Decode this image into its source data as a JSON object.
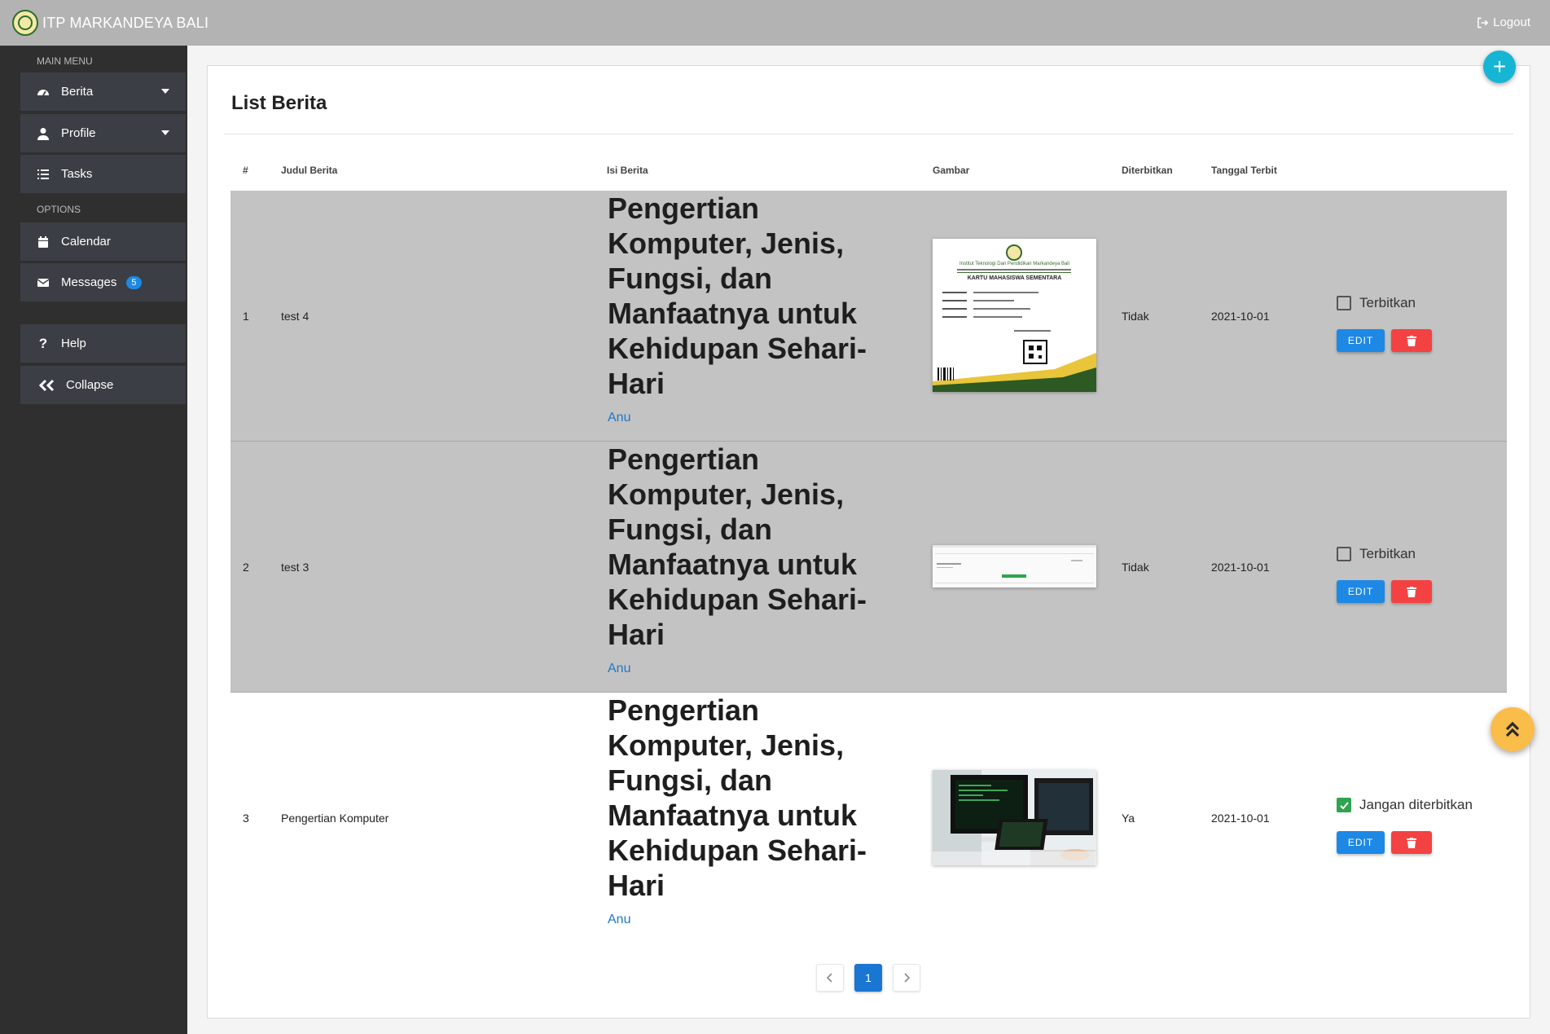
{
  "topbar": {
    "brand": "ITP MARKANDEYA BALI",
    "logout_label": "Logout"
  },
  "sidebar": {
    "main_menu_label": "MAIN MENU",
    "options_label": "OPTIONS",
    "items": {
      "berita": "Berita",
      "profile": "Profile",
      "tasks": "Tasks",
      "calendar": "Calendar",
      "messages": "Messages",
      "messages_count": "5",
      "help": "Help",
      "collapse": "Collapse"
    }
  },
  "page": {
    "title": "List Berita"
  },
  "table": {
    "headers": [
      "#",
      "Judul Berita",
      "Isi Berita",
      "Gambar",
      "Diterbitkan",
      "Tanggal Terbit"
    ],
    "rows": [
      {
        "no": "1",
        "judul": "test 4",
        "isi_heading": "Pengertian Komputer, Jenis, Fungsi, dan Manfaatnya untuk Kehidupan Sehari-Hari",
        "isi_sub": "Anu",
        "diterbitkan": "Tidak",
        "tanggal": "2021-10-01",
        "toggle_label": "Terbitkan",
        "published": false,
        "edit_label": "EDIT",
        "image": {
          "org": "Institut Teknologi Dan Pendidikan Markandeya Bali",
          "card_title": "KARTU MAHASISWA SEMENTARA"
        }
      },
      {
        "no": "2",
        "judul": "test 3",
        "isi_heading": "Pengertian Komputer, Jenis, Fungsi, dan Manfaatnya untuk Kehidupan Sehari-Hari",
        "isi_sub": "Anu",
        "diterbitkan": "Tidak",
        "tanggal": "2021-10-01",
        "toggle_label": "Terbitkan",
        "published": false,
        "edit_label": "EDIT"
      },
      {
        "no": "3",
        "judul": "Pengertian Komputer",
        "isi_heading": "Pengertian Komputer, Jenis, Fungsi, dan Manfaatnya untuk Kehidupan Sehari-Hari",
        "isi_sub": "Anu",
        "diterbitkan": "Ya",
        "tanggal": "2021-10-01",
        "toggle_label": "Jangan diterbitkan",
        "published": true,
        "edit_label": "EDIT"
      }
    ]
  },
  "pagination": {
    "current": "1"
  },
  "icons": {
    "logout": "sign-out-icon",
    "berita": "dashboard-gauge-icon",
    "profile": "user-icon",
    "tasks": "list-icon",
    "calendar": "calendar-icon",
    "messages": "envelope-icon",
    "help": "question-icon",
    "collapse": "double-chevron-left-icon",
    "add": "plus-icon",
    "delete": "trash-icon",
    "scroll_top": "double-chevron-up-icon",
    "prev": "chevron-left-icon",
    "next": "chevron-right-icon"
  },
  "colors": {
    "topbar": "#b3b3b3",
    "sidebar": "#2f2f2f",
    "accent": "#1e88e5",
    "danger": "#f44242",
    "fab_add": "#16b5d4",
    "fab_up": "#fbbd4a",
    "row_shade": "#c3c3c3",
    "published": "#2ea44f"
  }
}
